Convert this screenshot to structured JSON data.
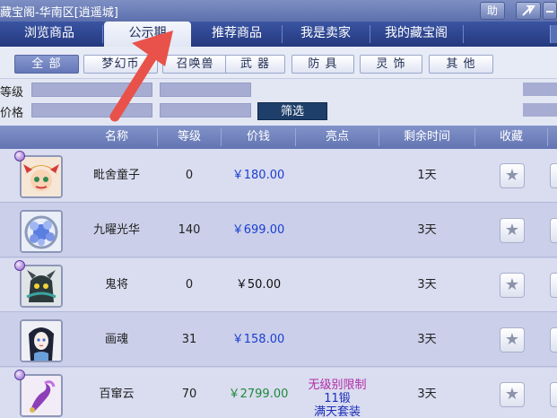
{
  "window": {
    "title": "藏宝阁-华南区[逍遥城]",
    "help_label": "助",
    "share_icon": "share-arrow-icon",
    "minimize_icon": "minimize-icon"
  },
  "tabs": [
    {
      "label": "浏览商品"
    },
    {
      "label": "公示期"
    },
    {
      "label": "推荐商品"
    },
    {
      "label": "我是卖家"
    },
    {
      "label": "我的藏宝阁"
    }
  ],
  "categories": [
    {
      "label": "全 部"
    },
    {
      "label": "梦幻币"
    },
    {
      "label": "召唤兽"
    },
    {
      "label": "武 器"
    },
    {
      "label": "防 具"
    },
    {
      "label": "灵 饰"
    },
    {
      "label": "其 他"
    }
  ],
  "filters": {
    "level_label": "等级",
    "price_label": "价格",
    "sift_label": "筛选"
  },
  "table": {
    "headers": [
      "名称",
      "等级",
      "价钱",
      "亮点",
      "剩余时间",
      "收藏"
    ],
    "rows": [
      {
        "name": "毗舍童子",
        "level": "0",
        "price": "￥180.00",
        "price_color": "blue",
        "highlight": [
          "",
          "",
          ""
        ],
        "time_left": "1天",
        "avatar_icon": "demon-child-avatar-icon"
      },
      {
        "name": "九曜光华",
        "level": "140",
        "price": "￥699.00",
        "price_color": "blue",
        "highlight": [
          "",
          "",
          ""
        ],
        "time_left": "3天",
        "avatar_icon": "gem-orb-avatar-icon"
      },
      {
        "name": "鬼将",
        "level": "0",
        "price": "￥50.00",
        "price_color": "black",
        "highlight": [
          "",
          "",
          ""
        ],
        "time_left": "3天",
        "avatar_icon": "ghost-general-avatar-icon"
      },
      {
        "name": "画魂",
        "level": "31",
        "price": "￥158.00",
        "price_color": "blue",
        "highlight": [
          "",
          "",
          ""
        ],
        "time_left": "3天",
        "avatar_icon": "painted-spirit-avatar-icon"
      },
      {
        "name": "百窜云",
        "level": "70",
        "price": "￥2799.00",
        "price_color": "green",
        "highlight": [
          "无级别限制",
          "11锻",
          "满天套装"
        ],
        "time_left": "3天",
        "avatar_icon": "cloud-staff-avatar-icon"
      }
    ]
  },
  "colors": {
    "price_blue": "#1a3fd1",
    "price_green": "#1e8a3a",
    "arrow": "#e8524a"
  }
}
